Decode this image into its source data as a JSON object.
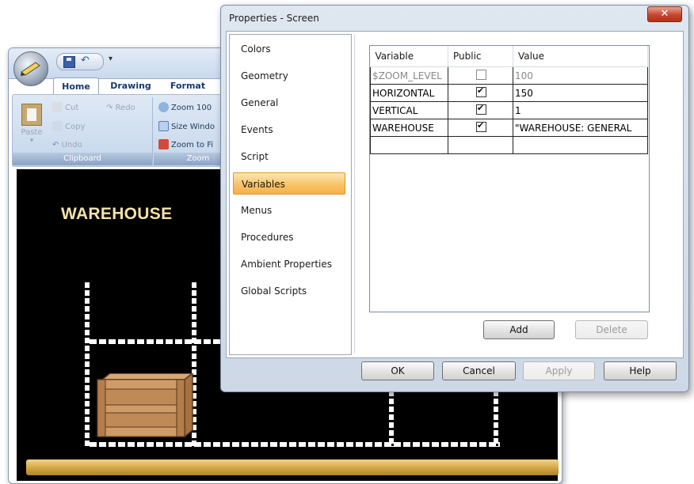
{
  "app": {
    "tabs": [
      "Home",
      "Drawing",
      "Format"
    ],
    "clipboard": {
      "paste": "Paste",
      "cut": "Cut",
      "redo": "Redo",
      "copy": "Copy",
      "undo": "Undo",
      "group_label": "Clipboard"
    },
    "zoom": {
      "zoom100": "Zoom 100",
      "size_window": "Size Windo",
      "zoom_to_fit": "Zoom to Fi",
      "group_label": "Zoom"
    },
    "canvas_title": "WAREHOUSE"
  },
  "dialog": {
    "title": "Properties - Screen",
    "close_glyph": "✕",
    "nav_items": [
      "Colors",
      "Geometry",
      "General",
      "Events",
      "Script",
      "Variables",
      "Menus",
      "Procedures",
      "Ambient Properties",
      "Global Scripts"
    ],
    "selected_nav": "Variables",
    "table": {
      "headers": [
        "Variable",
        "Public",
        "Value"
      ],
      "rows": [
        {
          "variable": "$ZOOM_LEVEL",
          "public": false,
          "value": "100"
        },
        {
          "variable": "HORIZONTAL",
          "public": true,
          "value": "150"
        },
        {
          "variable": "VERTICAL",
          "public": true,
          "value": "1"
        },
        {
          "variable": "WAREHOUSE",
          "public": true,
          "value": "\"WAREHOUSE: GENERAL"
        }
      ]
    },
    "buttons": {
      "add": "Add",
      "delete": "Delete",
      "ok": "OK",
      "cancel": "Cancel",
      "apply": "Apply",
      "help": "Help"
    }
  },
  "colors": {
    "accent_selected": "#f8c469",
    "canvas_bg": "#000000",
    "title_text": "#f3e3a8",
    "floor": "#d9ae4d",
    "crate": "#c08a56"
  }
}
